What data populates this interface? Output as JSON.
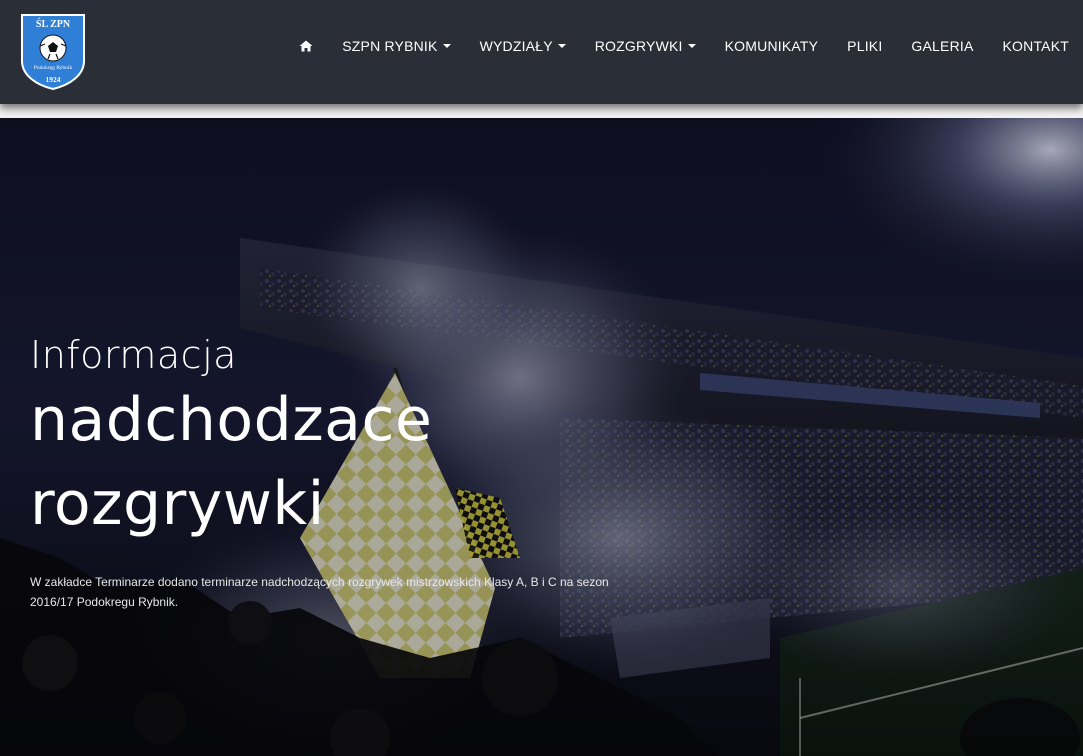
{
  "brand": {
    "logo_top": "ŚL ZPN",
    "logo_bottom": "Podokręg Rybnik",
    "logo_year": "1924",
    "logo_color": "#2f7fd6"
  },
  "nav": {
    "home_icon": "home-icon",
    "items": [
      {
        "label": "SZPN RYBNIK",
        "dropdown": true
      },
      {
        "label": "WYDZIAŁY",
        "dropdown": true
      },
      {
        "label": "ROZGRYWKI",
        "dropdown": true
      },
      {
        "label": "KOMUNIKATY",
        "dropdown": false
      },
      {
        "label": "PLIKI",
        "dropdown": false
      },
      {
        "label": "GALERIA",
        "dropdown": false
      },
      {
        "label": "KONTAKT",
        "dropdown": false
      }
    ]
  },
  "hero": {
    "kicker": "Informacja",
    "title_line1": "nadchodzace",
    "title_line2": "rozgrywki",
    "description": "W zakładce Terminarze dodano terminarze nadchodzących rozgrywek mistrzowskich Klasy A, B i C na sezon 2016/17 Podokregu Rybnik.",
    "background": "stadium-crowd-smoke-image"
  },
  "colors": {
    "navbar": "#2a2f37",
    "text": "#ffffff"
  }
}
